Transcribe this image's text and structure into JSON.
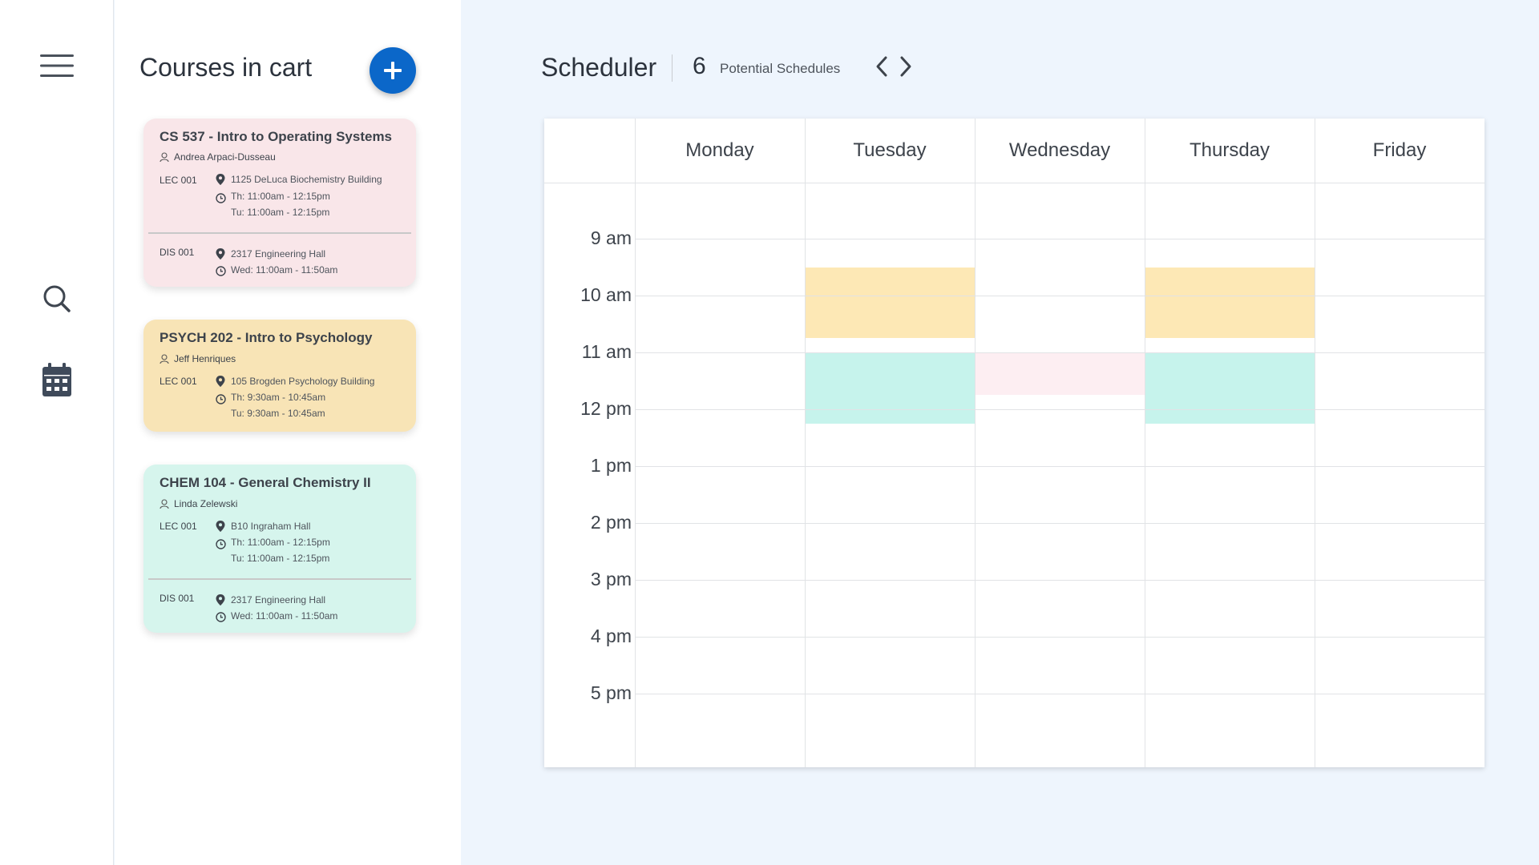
{
  "cart": {
    "title": "Courses in cart",
    "add_button_icon": "plus-icon",
    "courses": [
      {
        "title": "CS 537 - Intro to Operating Systems",
        "instructor": "Andrea Arpaci-Dusseau",
        "color": "#f9e6e9",
        "lec": {
          "label": "LEC 001",
          "location": "1125 DeLuca Biochemistry Building",
          "time1": "Th: 11:00am - 12:15pm",
          "time2": "Tu: 11:00am - 12:15pm"
        },
        "dis": {
          "label": "DIS 001",
          "location": "2317 Engineering Hall",
          "time": "Wed: 11:00am - 11:50am"
        }
      },
      {
        "title": "PSYCH 202 - Intro to Psychology",
        "instructor": "Jeff Henriques",
        "color": "#f8e4b6",
        "lec": {
          "label": "LEC 001",
          "location": "105 Brogden Psychology Building",
          "time1": "Th: 9:30am - 10:45am",
          "time2": "Tu: 9:30am - 10:45am"
        }
      },
      {
        "title": "CHEM 104 - General Chemistry II",
        "instructor": "Linda Zelewski",
        "color": "#d6f5ed",
        "lec": {
          "label": "LEC 001",
          "location": "B10 Ingraham Hall",
          "time1": "Th: 11:00am - 12:15pm",
          "time2": "Tu: 11:00am - 12:15pm"
        },
        "dis": {
          "label": "DIS 001",
          "location": "2317 Engineering Hall",
          "time": "Wed: 11:00am - 11:50am"
        }
      }
    ]
  },
  "scheduler": {
    "title": "Scheduler",
    "count": "6",
    "count_label": "Potential Schedules",
    "prev_icon": "chevron-left-icon",
    "next_icon": "chevron-right-icon",
    "days": [
      "Monday",
      "Tuesday",
      "Wednesday",
      "Thursday",
      "Friday"
    ],
    "hours": [
      "9 am",
      "10 am",
      "11 am",
      "12 pm",
      "1 pm",
      "2 pm",
      "3 pm",
      "4 pm",
      "5 pm"
    ],
    "events": [
      {
        "day": 1,
        "start": 9.5,
        "end": 10.75,
        "color": "#fde8b5"
      },
      {
        "day": 3,
        "start": 9.5,
        "end": 10.75,
        "color": "#fde8b5"
      },
      {
        "day": 1,
        "start": 11.0,
        "end": 12.25,
        "color": "#c6f3ec"
      },
      {
        "day": 3,
        "start": 11.0,
        "end": 12.25,
        "color": "#c6f3ec"
      },
      {
        "day": 2,
        "start": 11.0,
        "end": 11.75,
        "color": "#fdeef2"
      }
    ]
  },
  "rail": {
    "icons": [
      "menu-icon",
      "search-icon",
      "calendar-icon"
    ]
  }
}
